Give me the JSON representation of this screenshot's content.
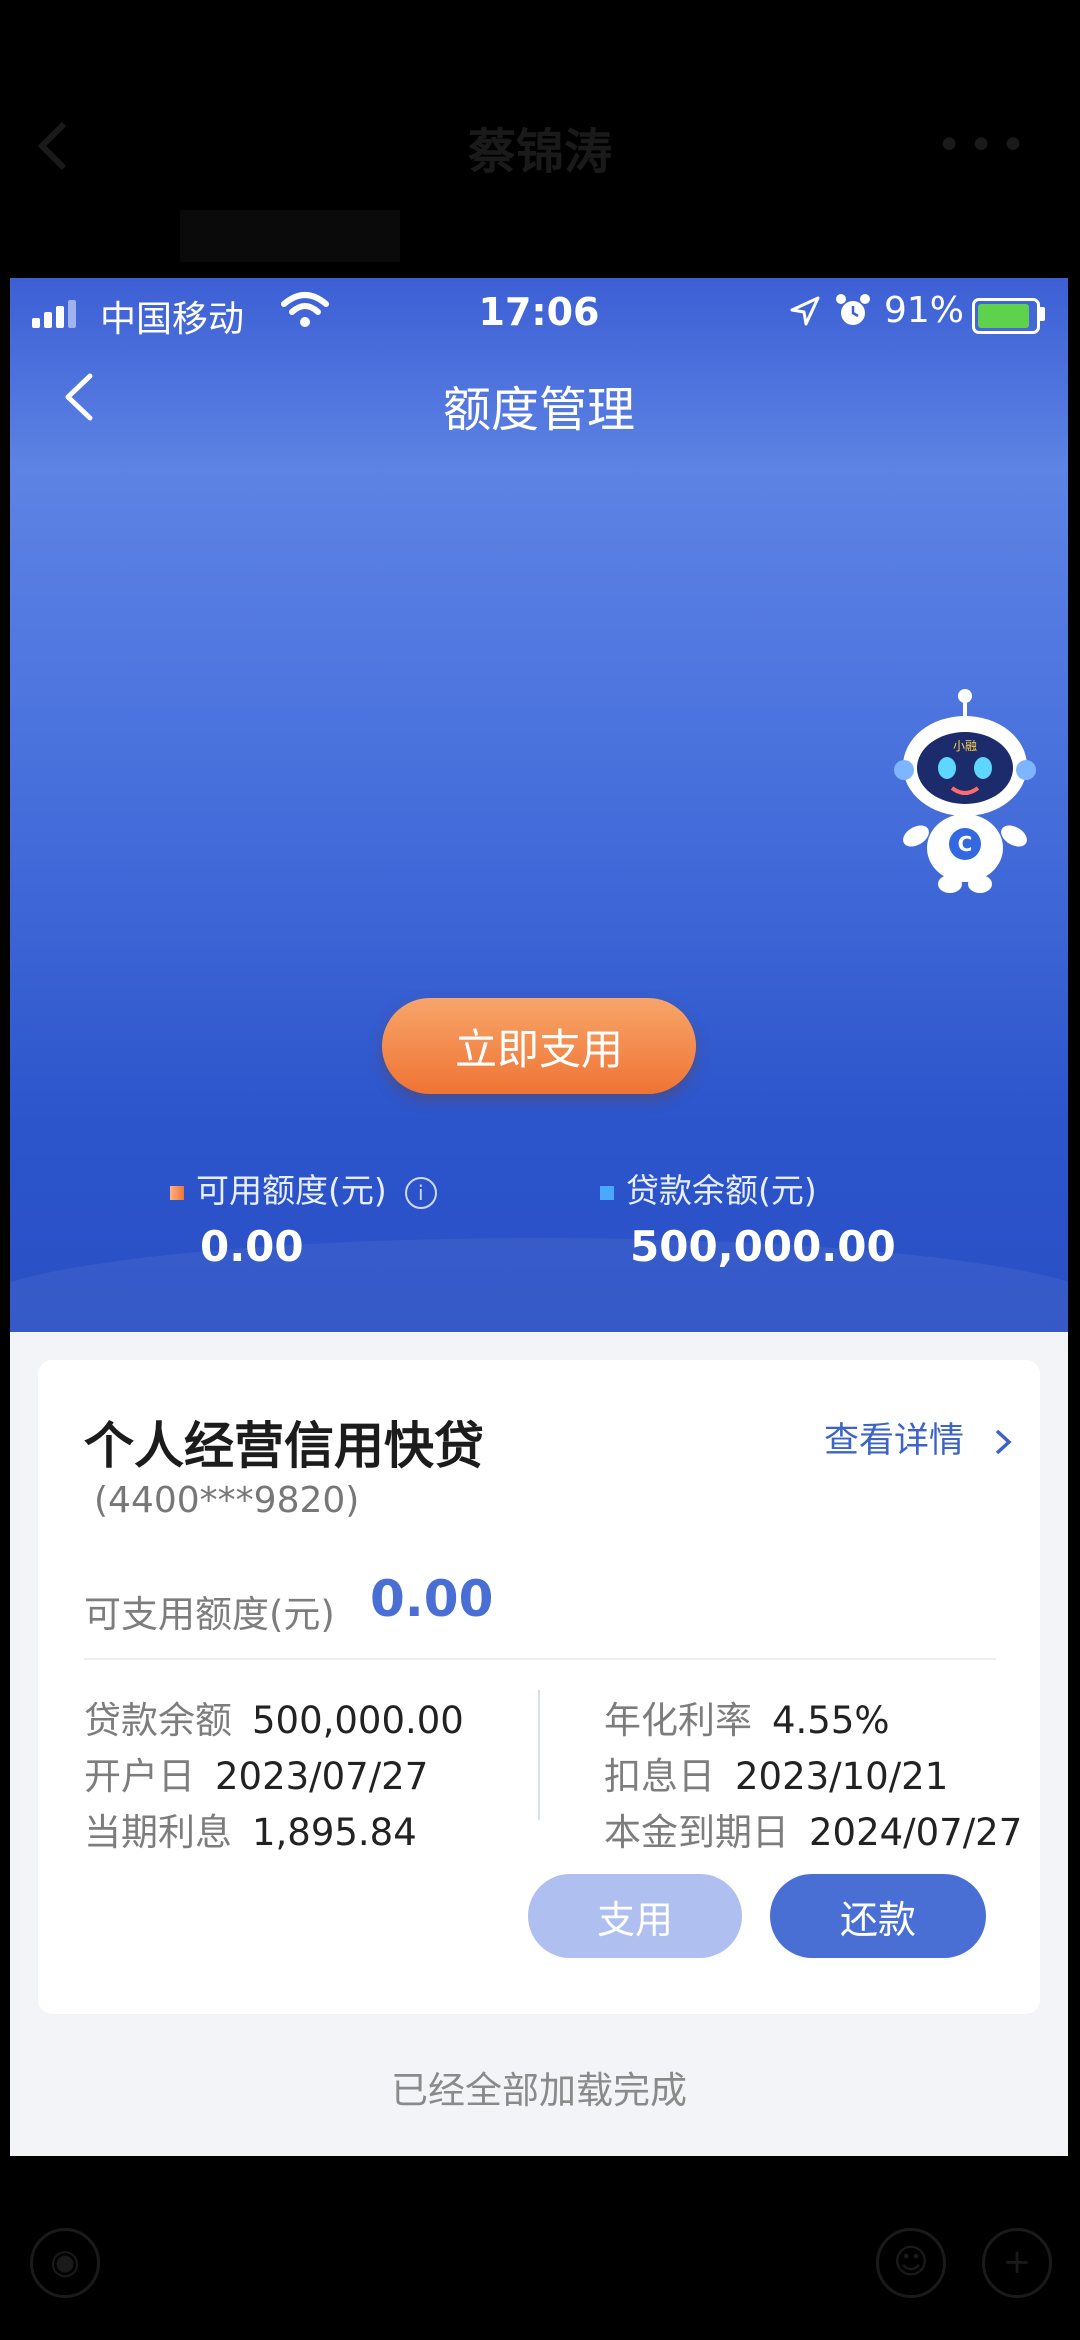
{
  "outer": {
    "title": "蔡锦涛",
    "more_icon": "more-icon",
    "back_icon": "chevron-left-icon"
  },
  "status_bar": {
    "carrier": "中国移动",
    "time": "17:06",
    "battery": "91%",
    "battery_level": 0.91
  },
  "header": {
    "title": "额度管理"
  },
  "hero": {
    "use_button": "立即支用",
    "available_label": "可用额度(元)",
    "available_value": "0.00",
    "balance_label": "贷款余额(元)",
    "balance_value": "500,000.00",
    "robot_badge": "小融"
  },
  "loan": {
    "name": "个人经营信用快贷",
    "account": "(4400***9820)",
    "detail_link": "查看详情",
    "avail_label": "可支用额度(元)",
    "avail_value": "0.00",
    "fields_left": [
      {
        "label": "贷款余额",
        "value": "500,000.00"
      },
      {
        "label": "开户日",
        "value": "2023/07/27"
      },
      {
        "label": "当期利息",
        "value": "1,895.84"
      }
    ],
    "fields_right": [
      {
        "label": "年化利率",
        "value": "4.55%"
      },
      {
        "label": "扣息日",
        "value": "2023/10/21"
      },
      {
        "label": "本金到期日",
        "value": "2024/07/27"
      }
    ],
    "btn_use": "支用",
    "btn_repay": "还款"
  },
  "footer": {
    "loaded_text": "已经全部加载完成"
  },
  "colors": {
    "accent": "#4a6fd4",
    "orange": "#ef7434"
  }
}
